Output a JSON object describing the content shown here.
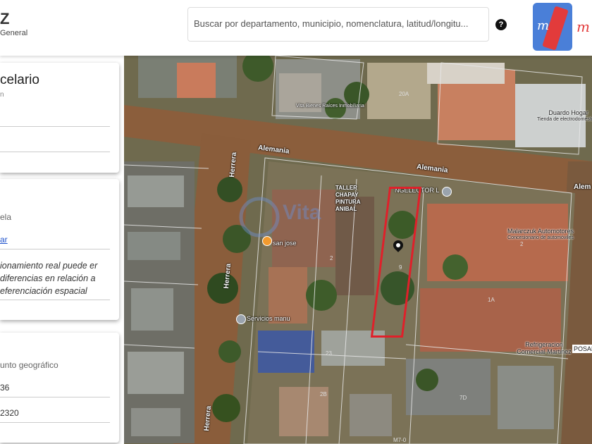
{
  "header": {
    "logo_mark": "Z",
    "logo_line1": "General",
    "search": {
      "placeholder": "Buscar por departamento, municipio, nomenclatura, latitud/longitu..."
    },
    "help_icon": "question-circle-icon",
    "brand_scribble": "m"
  },
  "panel": {
    "card1": {
      "title": "celario",
      "subtitle": "n"
    },
    "card2": {
      "line1": "ela",
      "link": "ar",
      "note": "ionamiento real puede er diferencias en relación a eferenciación espacial"
    },
    "card3": {
      "label": "unto geográfico",
      "value1": "36",
      "value2": "2320"
    }
  },
  "map": {
    "streets": [
      "Alemania",
      "Alemania",
      "Alem",
      "Herrera",
      "Herrera",
      "Herrera"
    ],
    "pois": [
      {
        "name": "Servicios manu",
        "icon": "location-icon"
      },
      {
        "name": "san jose",
        "icon": "location-icon"
      },
      {
        "name": "NGELECTOR L",
        "icon": "location-icon"
      }
    ],
    "businesses": [
      {
        "name": "Duardo Hogar",
        "category": "Tienda de electrodomésticos"
      },
      {
        "name": "TALLER CHAPAY PINTURA ANIBAL"
      },
      {
        "name": "Malarczuk Automotores",
        "category": "Concesionario de automóviles"
      },
      {
        "name": "Refrigeracion Comercial Martinez"
      },
      {
        "name": "POSAD"
      }
    ],
    "lot_numbers": [
      "20A",
      "2",
      "9",
      "2",
      "1A",
      "23",
      "2B",
      "7D",
      "M7-0"
    ],
    "watermark": "Vita Bienes Raíces Inmobiliaria",
    "highlight_color": "#e0202a"
  }
}
